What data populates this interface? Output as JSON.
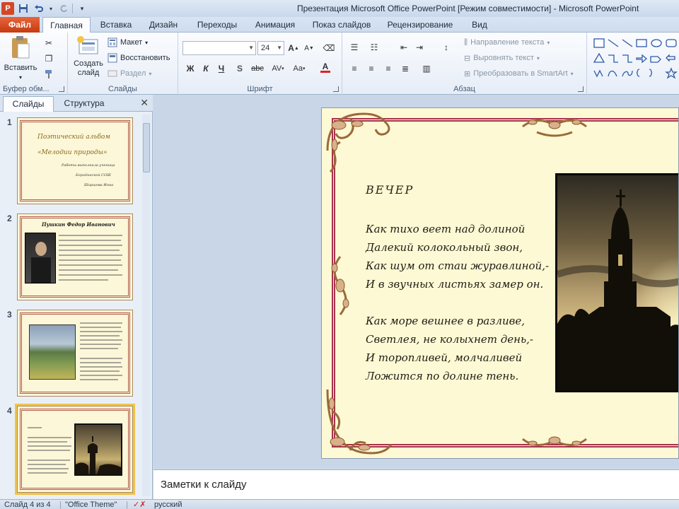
{
  "window": {
    "title": "Презентация Microsoft Office PowerPoint [Режим совместимости]  -  Microsoft PowerPoint",
    "app_badge": "P"
  },
  "tabs": {
    "file": "Файл",
    "home": "Главная",
    "insert": "Вставка",
    "design": "Дизайн",
    "transitions": "Переходы",
    "animations": "Анимация",
    "slideshow": "Показ слайдов",
    "review": "Рецензирование",
    "view": "Вид"
  },
  "ribbon": {
    "clipboard": {
      "paste": "Вставить",
      "label": "Буфер обм..."
    },
    "slides": {
      "new_slide_line1": "Создать",
      "new_slide_line2": "слайд",
      "layout": "Макет",
      "reset": "Восстановить",
      "section": "Раздел",
      "label": "Слайды"
    },
    "font": {
      "size": "24",
      "bold": "Ж",
      "italic": "К",
      "underline": "Ч",
      "shadow": "S",
      "strike": "abc",
      "spacing": "AV",
      "case": "Aa",
      "grow": "A",
      "shrink": "A",
      "color": "A",
      "label": "Шрифт"
    },
    "paragraph": {
      "text_direction": "Направление текста",
      "align_text": "Выровнять текст",
      "smartart": "Преобразовать в SmartArt",
      "label": "Абзац"
    }
  },
  "left_panel": {
    "tab_slides": "Слайды",
    "tab_outline": "Структура",
    "close": "✕",
    "slides": [
      {
        "num": "1",
        "lines": [
          "Поэтический альбом",
          "«Мелодии природы»",
          "Работы выполнила ученица",
          "Бородинской СОШ",
          "Ширшова Инна"
        ]
      },
      {
        "num": "2",
        "title": "Пушкин Федор Иванович"
      },
      {
        "num": "3"
      },
      {
        "num": "4"
      }
    ]
  },
  "slide": {
    "title": "ВЕЧЕР",
    "stanza1": [
      "Как тихо веет над долиной",
      "Далекий колокольный звон,",
      "Как шум от стаи журавлиной,-",
      "И в звучных листьях замер он."
    ],
    "stanza2": [
      "Как море вешнее в разливе,",
      "Светлея, не колыхнет день,-",
      "И торопливей, молчаливей",
      "Ложится по долине тень."
    ]
  },
  "notes": {
    "placeholder": "Заметки к слайду"
  },
  "status": {
    "slide_counter": "Слайд 4 из 4",
    "theme": "\"Office Theme\"",
    "language": "русский"
  },
  "colors": {
    "file_tab": "#d24726",
    "slide_bg": "#fdf9d4",
    "slide_border": "#a8324c",
    "selected_thumb": "#f2c34a"
  }
}
